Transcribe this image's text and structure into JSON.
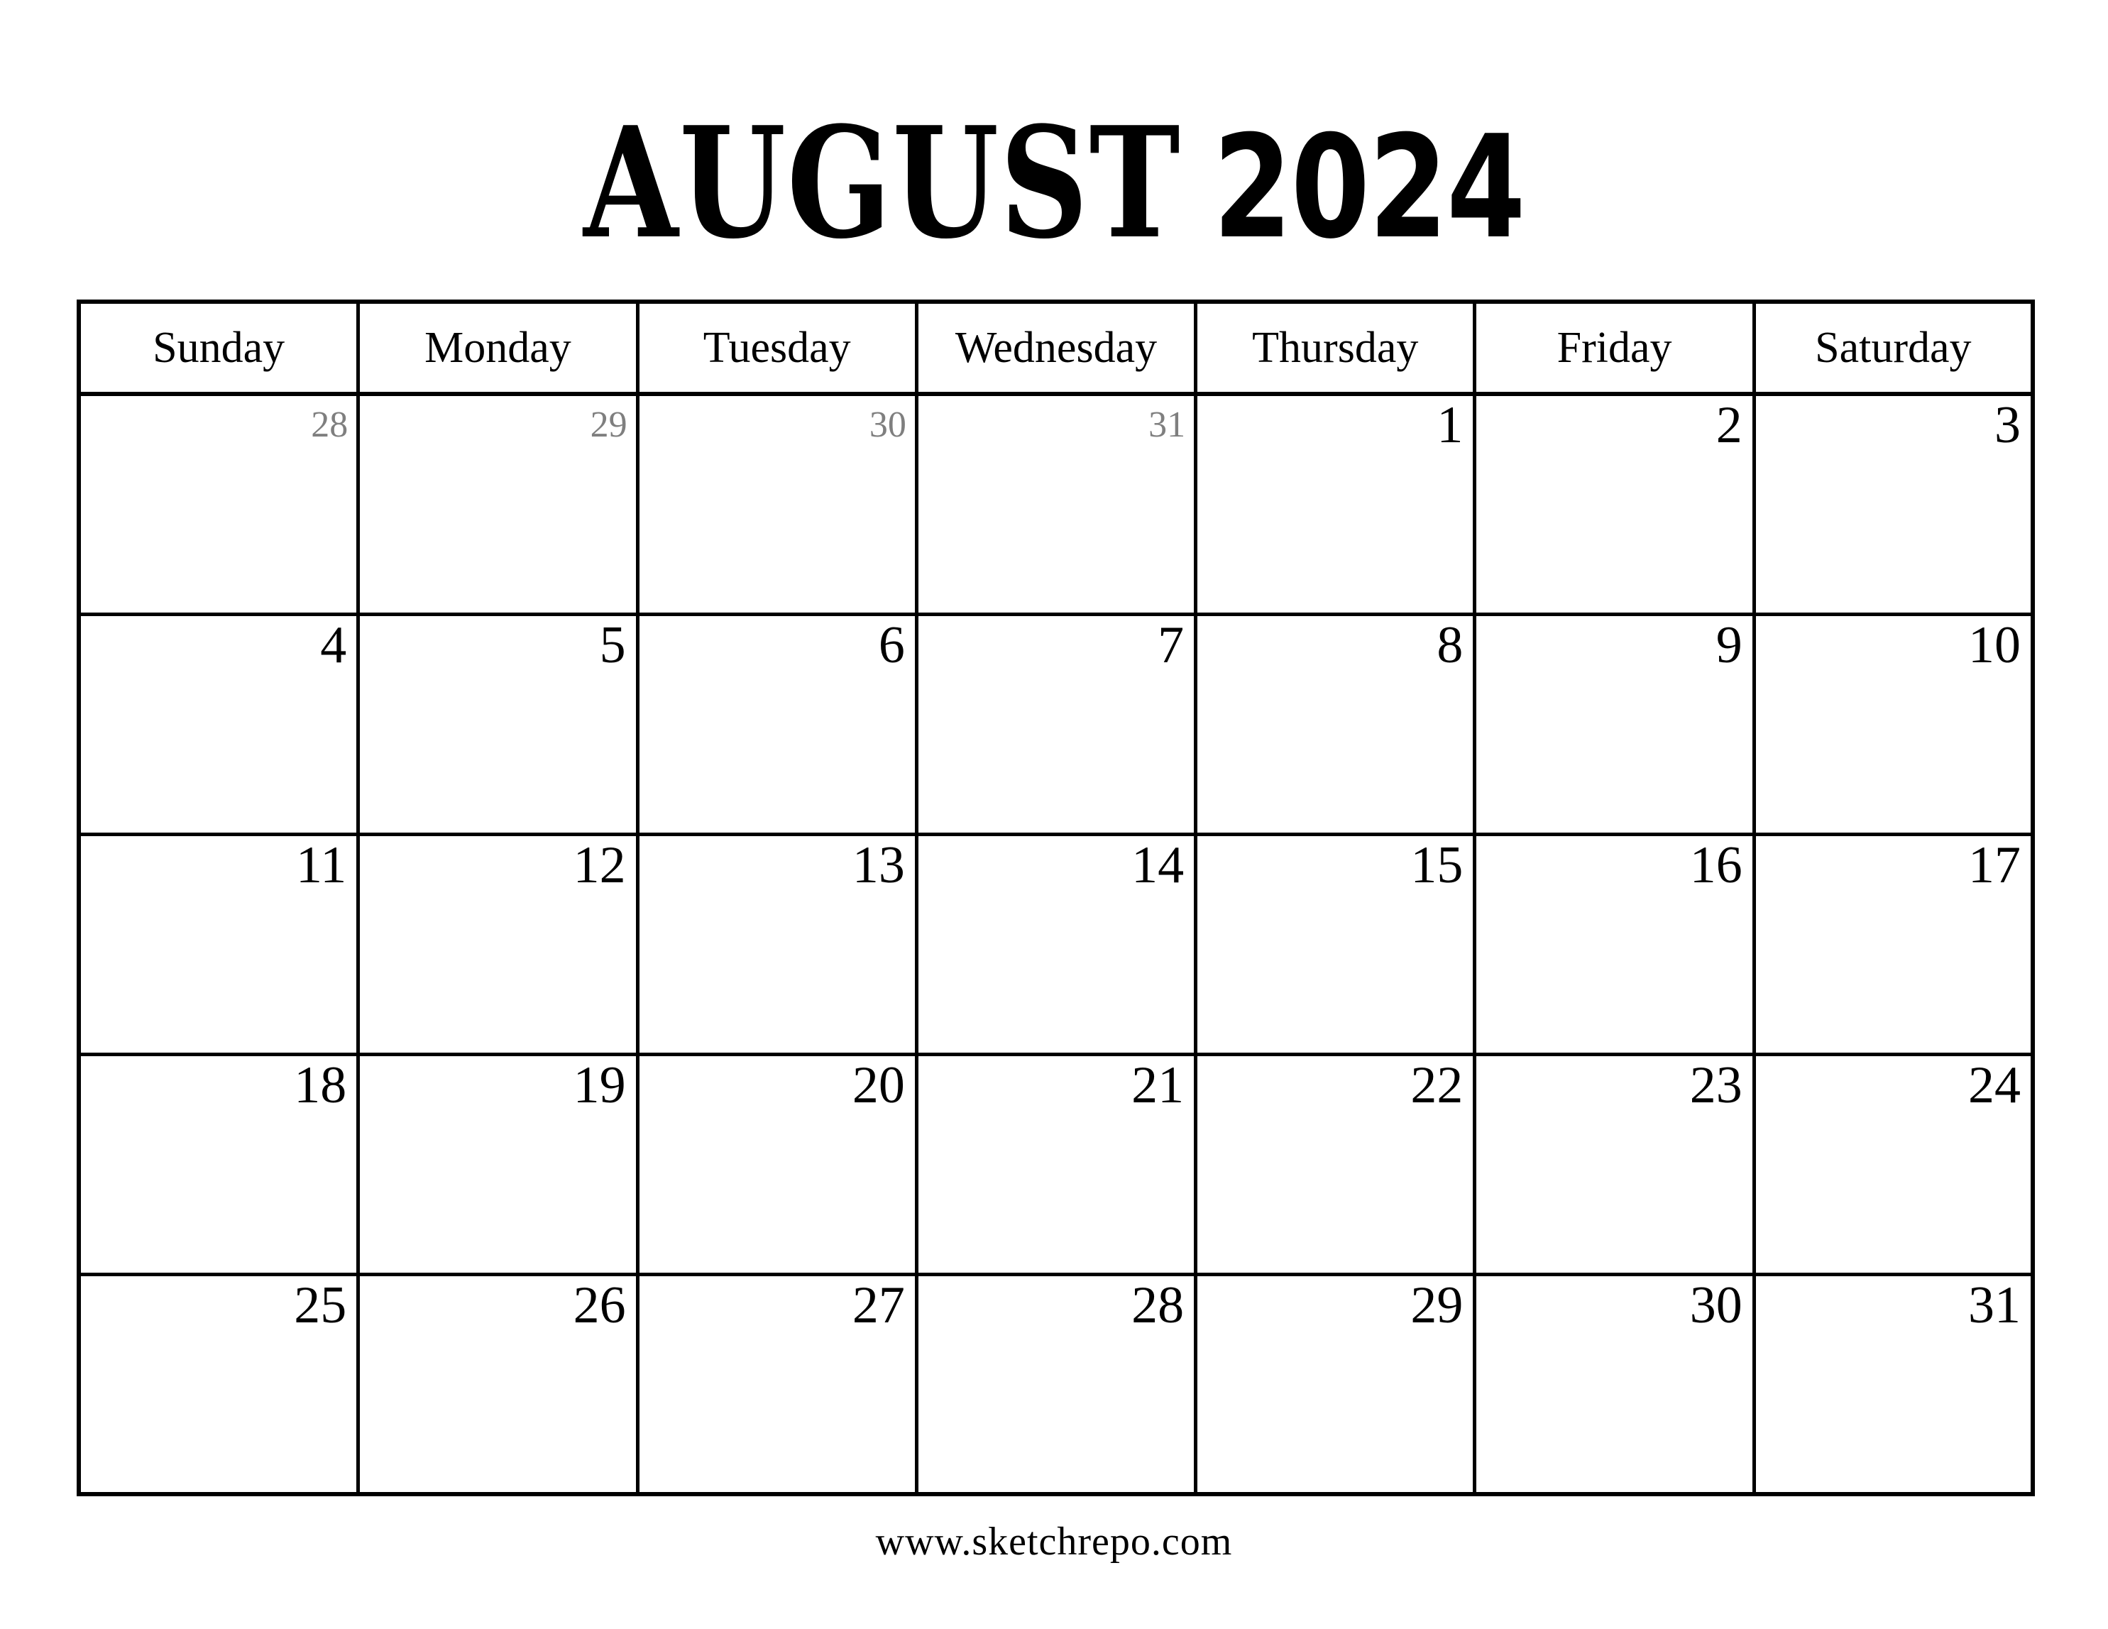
{
  "header": {
    "month_label": "AUGUST",
    "year_label": "2024"
  },
  "calendar": {
    "weekday_headers": [
      "Sunday",
      "Monday",
      "Tuesday",
      "Wednesday",
      "Thursday",
      "Friday",
      "Saturday"
    ],
    "weeks": [
      [
        {
          "day": "28",
          "muted": true
        },
        {
          "day": "29",
          "muted": true
        },
        {
          "day": "30",
          "muted": true
        },
        {
          "day": "31",
          "muted": true
        },
        {
          "day": "1",
          "muted": false
        },
        {
          "day": "2",
          "muted": false
        },
        {
          "day": "3",
          "muted": false
        }
      ],
      [
        {
          "day": "4",
          "muted": false
        },
        {
          "day": "5",
          "muted": false
        },
        {
          "day": "6",
          "muted": false
        },
        {
          "day": "7",
          "muted": false
        },
        {
          "day": "8",
          "muted": false
        },
        {
          "day": "9",
          "muted": false
        },
        {
          "day": "10",
          "muted": false
        }
      ],
      [
        {
          "day": "11",
          "muted": false
        },
        {
          "day": "12",
          "muted": false
        },
        {
          "day": "13",
          "muted": false
        },
        {
          "day": "14",
          "muted": false
        },
        {
          "day": "15",
          "muted": false
        },
        {
          "day": "16",
          "muted": false
        },
        {
          "day": "17",
          "muted": false
        }
      ],
      [
        {
          "day": "18",
          "muted": false
        },
        {
          "day": "19",
          "muted": false
        },
        {
          "day": "20",
          "muted": false
        },
        {
          "day": "21",
          "muted": false
        },
        {
          "day": "22",
          "muted": false
        },
        {
          "day": "23",
          "muted": false
        },
        {
          "day": "24",
          "muted": false
        }
      ],
      [
        {
          "day": "25",
          "muted": false
        },
        {
          "day": "26",
          "muted": false
        },
        {
          "day": "27",
          "muted": false
        },
        {
          "day": "28",
          "muted": false
        },
        {
          "day": "29",
          "muted": false
        },
        {
          "day": "30",
          "muted": false
        },
        {
          "day": "31",
          "muted": false
        }
      ]
    ]
  },
  "footer": {
    "website": "www.sketchrepo.com"
  },
  "colors": {
    "ink": "#000000",
    "muted_day": "#7f7f7f",
    "page_background": "#ffffff",
    "grid_line": "#000000"
  }
}
